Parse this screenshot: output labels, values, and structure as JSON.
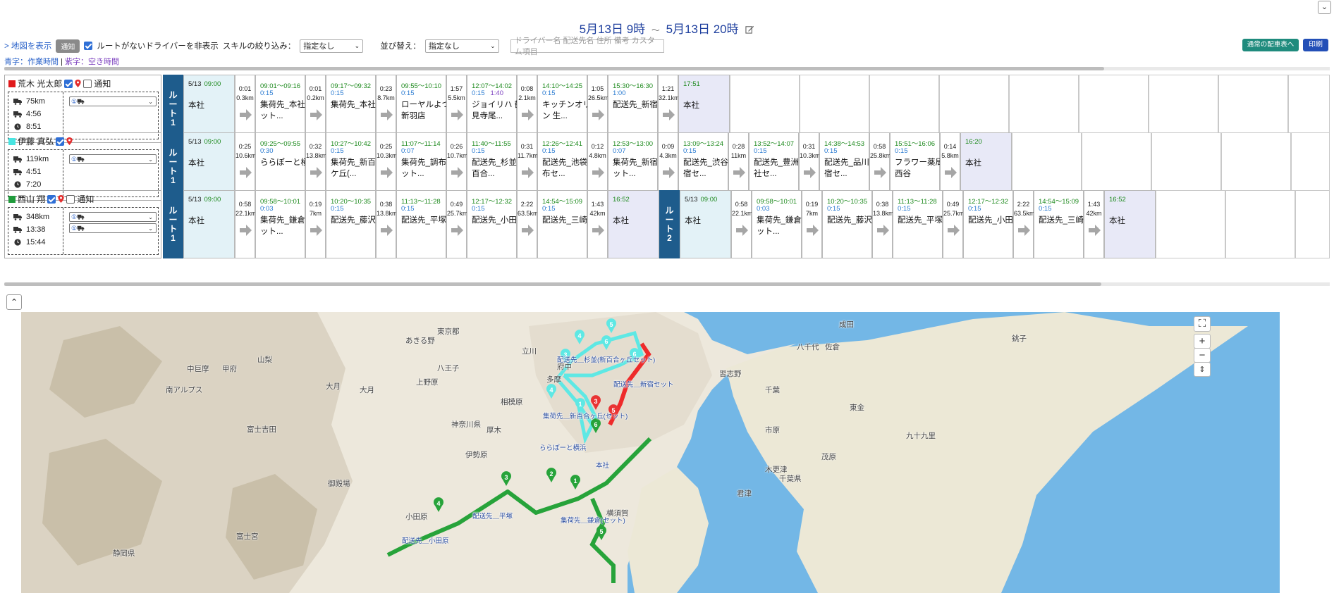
{
  "header": {
    "date_start": "5月13日 9時",
    "tilde": "～",
    "date_end": "5月13日 20時"
  },
  "toolbar": {
    "map_link": "> 地図を表示",
    "notify_btn": "通知",
    "hide_label": "ルートがないドライバーを非表示",
    "skill_label": "スキルの絞り込み：",
    "skill_value": "指定なし",
    "sort_label": "並び替え：",
    "sort_value": "指定なし",
    "search_placeholder": "ドライバー名 配送先名 住所 備考 カスタム項目",
    "normal_btn": "通常の配車表へ",
    "print_btn": "印刷"
  },
  "legend": {
    "blue": "青字：作業時間",
    "sep": " | ",
    "purple": "紫字：空き時間"
  },
  "route_label": "ルート",
  "drivers": [
    {
      "name": "荒木 光太郎",
      "color": "#e0191b",
      "notify": "通知",
      "distance": "75km",
      "work": "4:56",
      "total": "8:51",
      "vehicles": [
        "① "
      ],
      "routes": [
        {
          "no": "1",
          "start": {
            "date": "5/13",
            "time": "09:00",
            "name": "本社"
          },
          "stops": [
            {
              "t1": "0:01",
              "t2": "0.3km",
              "time": "09:01～09:16",
              "dur": "0:15",
              "name": "集荷先_本社(セット..."
            },
            {
              "t1": "0:01",
              "t2": "0.2km",
              "time": "09:17～09:32",
              "dur": "0:15",
              "name": "集荷先_本社"
            },
            {
              "t1": "0:23",
              "t2": "8.7km",
              "time": "09:55～10:10",
              "dur": "0:15",
              "name": "ローヤルよつや 新羽店"
            },
            {
              "t1": "1:57",
              "t2": "5.5km",
              "time": "12:07～14:02",
              "dur": "0:15",
              "idle": "1:40",
              "name": "ジョイリハ 鶴見寺尾..."
            },
            {
              "t1": "0:08",
              "t2": "2.1km",
              "time": "14:10～14:25",
              "dur": "0:15",
              "name": "キッチンオリジン 生..."
            },
            {
              "t1": "1:05",
              "t2": "26.5km",
              "time": "15:30～16:30",
              "dur": "1:00",
              "name": "配送先_新宿"
            }
          ],
          "end": {
            "t1": "1:21",
            "t2": "32.1km",
            "time": "17:51",
            "name": "本社"
          }
        }
      ]
    },
    {
      "name": "伊藤 真弘",
      "color": "#48e5e2",
      "distance": "119km",
      "work": "4:51",
      "total": "7:20",
      "vehicles": [
        "① "
      ],
      "routes": [
        {
          "no": "1",
          "start": {
            "date": "5/13",
            "time": "09:00",
            "name": "本社"
          },
          "stops": [
            {
              "t1": "0:25",
              "t2": "10.6km",
              "time": "09:25～09:55",
              "dur": "0:30",
              "name": "ららぽーと横浜"
            },
            {
              "t1": "0:32",
              "t2": "13.8km",
              "time": "10:27～10:42",
              "dur": "0:15",
              "name": "集荷先_新百合ケ丘(..."
            },
            {
              "t1": "0:25",
              "t2": "10.3km",
              "time": "11:07～11:14",
              "dur": "0:07",
              "name": "集荷先_調布(セット..."
            },
            {
              "t1": "0:26",
              "t2": "10.7km",
              "time": "11:40～11:55",
              "dur": "0:15",
              "name": "配送先_杉並(新百合..."
            },
            {
              "t1": "0:31",
              "t2": "11.7km",
              "time": "12:26～12:41",
              "dur": "0:15",
              "name": "配送先_池袋(調布セ..."
            },
            {
              "t1": "0:12",
              "t2": "4.8km",
              "time": "12:53～13:00",
              "dur": "0:07",
              "name": "集荷先_新宿(セット..."
            },
            {
              "t1": "0:09",
              "t2": "4.3km",
              "time": "13:09～13:24",
              "dur": "0:15",
              "name": "配送先_渋谷(新宿セ..."
            },
            {
              "t1": "0:28",
              "t2": "11km",
              "time": "13:52～14:07",
              "dur": "0:15",
              "name": "配送先_豊洲(本社セ..."
            },
            {
              "t1": "0:31",
              "t2": "10.3km",
              "time": "14:38～14:53",
              "dur": "0:15",
              "name": "配送先_品川(新宿セ..."
            },
            {
              "t1": "0:58",
              "t2": "25.8km",
              "time": "15:51～16:06",
              "dur": "0:15",
              "name": "フラワー薬局 西谷"
            }
          ],
          "end": {
            "t1": "0:14",
            "t2": "5.8km",
            "time": "16:20",
            "name": "本社"
          }
        }
      ]
    },
    {
      "name": "西山 翔",
      "color": "#1f9b3b",
      "notify": "通知",
      "distance": "348km",
      "work": "13:38",
      "total": "15:44",
      "vehicles": [
        "① ",
        "① "
      ],
      "routes": [
        {
          "no": "1",
          "start": {
            "date": "5/13",
            "time": "09:00",
            "name": "本社"
          },
          "stops": [
            {
              "t1": "0:58",
              "t2": "22.1km",
              "time": "09:58～10:01",
              "dur": "0:03",
              "name": "集荷先_鎌倉(セット..."
            },
            {
              "t1": "0:19",
              "t2": "7km",
              "time": "10:20～10:35",
              "dur": "0:15",
              "name": "配送先_藤沢"
            },
            {
              "t1": "0:38",
              "t2": "13.8km",
              "time": "11:13～11:28",
              "dur": "0:15",
              "name": "配送先_平塚"
            },
            {
              "t1": "0:49",
              "t2": "25.7km",
              "time": "12:17～12:32",
              "dur": "0:15",
              "name": "配送先_小田原"
            },
            {
              "t1": "2:22",
              "t2": "63.5km",
              "time": "14:54～15:09",
              "dur": "0:15",
              "name": "配送先_三崎"
            }
          ],
          "end": {
            "t1": "1:43",
            "t2": "42km",
            "time": "16:52",
            "name": "本社"
          }
        },
        {
          "no": "2",
          "start": {
            "date": "5/13",
            "time": "09:00",
            "name": "本社"
          },
          "stops": [
            {
              "t1": "0:58",
              "t2": "22.1km",
              "time": "09:58～10:01",
              "dur": "0:03",
              "name": "集荷先_鎌倉(セット..."
            },
            {
              "t1": "0:19",
              "t2": "7km",
              "time": "10:20～10:35",
              "dur": "0:15",
              "name": "配送先_藤沢"
            },
            {
              "t1": "0:38",
              "t2": "13.8km",
              "time": "11:13～11:28",
              "dur": "0:15",
              "name": "配送先_平塚"
            },
            {
              "t1": "0:49",
              "t2": "25.7km",
              "time": "12:17～12:32",
              "dur": "0:15",
              "name": "配送先_小田原"
            },
            {
              "t1": "2:22",
              "t2": "63.5km",
              "time": "14:54～15:09",
              "dur": "0:15",
              "name": "配送先_三崎"
            }
          ],
          "end": {
            "t1": "1:43",
            "t2": "42km",
            "time": "16:52",
            "name": "本社"
          }
        }
      ]
    }
  ],
  "map": {
    "controls": {
      "fullscreen": "⛶",
      "zoom_in": "+",
      "zoom_out": "−",
      "compass": "⇕"
    },
    "place_labels": [
      "東京都",
      "あきる野",
      "立川",
      "八王子",
      "府中",
      "多摩",
      "上野原",
      "大月",
      "中巨摩",
      "甲府",
      "南アルプス",
      "山梨",
      "相模原",
      "神奈川県",
      "厚木",
      "伊勢原",
      "富士吉田",
      "御殿場",
      "小田原",
      "富士宮",
      "静岡県",
      "横須賀",
      "木更津",
      "君津",
      "市原",
      "千葉",
      "千葉県",
      "佐倉",
      "八千代",
      "成田",
      "東金",
      "茂原",
      "銚子",
      "九十九里",
      "習志野",
      "大月"
    ],
    "route_labels": [
      "配送先＿杉並(新百合ヶ丘セット)",
      "配送先＿新宿セット",
      "集荷先＿新百合ヶ丘(セット)",
      "ららぽーと横浜",
      "配送先＿平塚",
      "集荷先＿鎌倉(セット)",
      "配送先＿小田原",
      "本社"
    ],
    "markers": {
      "red": [
        "3",
        "5"
      ],
      "cyan": [
        "4",
        "5",
        "6",
        "3",
        "1",
        "6",
        "4"
      ],
      "green": [
        "6",
        "1",
        "2",
        "3",
        "4",
        "5"
      ]
    }
  }
}
